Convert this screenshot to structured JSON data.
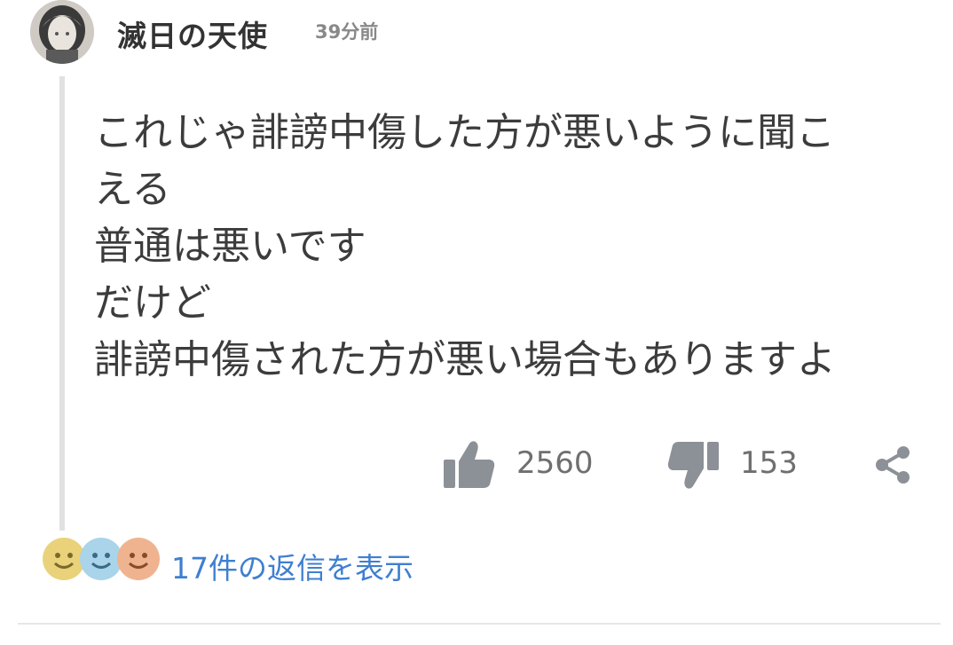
{
  "comment": {
    "username": "滅日の天使",
    "timestamp": "39分前",
    "lines": [
      "これじゃ誹謗中傷した方が悪いように聞こ",
      "える",
      "普通は悪いです",
      "だけど",
      "誹謗中傷された方が悪い場合もありますよ"
    ],
    "likes": "2560",
    "dislikes": "153",
    "replies_label": "17件の返信を表示"
  },
  "icons": {
    "like": "thumbs-up-icon",
    "dislike": "thumbs-down-icon",
    "share": "share-icon"
  },
  "colors": {
    "icon_gray": "#8c9097",
    "link_blue": "#3f7fd0",
    "face_yellow": "#e9d27a",
    "face_blue": "#a9d4ea",
    "face_orange": "#f0b38f"
  }
}
